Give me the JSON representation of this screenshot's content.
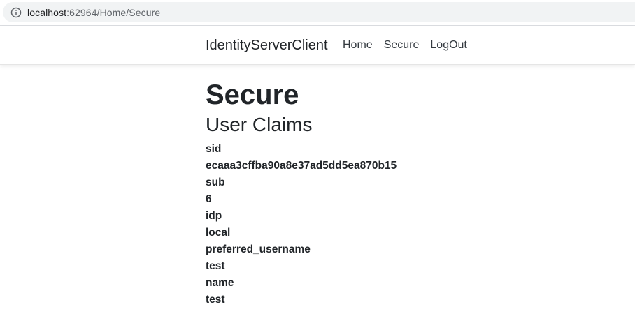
{
  "address_bar": {
    "url_host": "localhost",
    "url_rest": ":62964/Home/Secure",
    "icon": "info-icon"
  },
  "navbar": {
    "brand": "IdentityServerClient",
    "links": [
      {
        "label": "Home"
      },
      {
        "label": "Secure"
      },
      {
        "label": "LogOut"
      }
    ]
  },
  "main": {
    "title": "Secure",
    "subtitle": "User Claims",
    "claims": [
      {
        "type": "sid",
        "value": "ecaaa3cffba90a8e37ad5dd5ea870b15"
      },
      {
        "type": "sub",
        "value": "6"
      },
      {
        "type": "idp",
        "value": "local"
      },
      {
        "type": "preferred_username",
        "value": "test"
      },
      {
        "type": "name",
        "value": "test"
      }
    ]
  }
}
